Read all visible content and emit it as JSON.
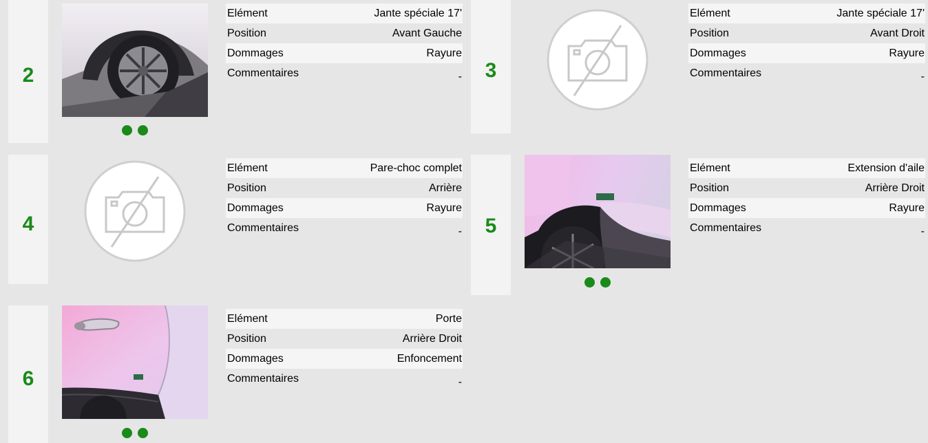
{
  "labels": {
    "element": "Elément",
    "position": "Position",
    "damages": "Dommages",
    "comments": "Commentaires"
  },
  "colors": {
    "accent_green": "#1a8a1a",
    "background": "#e6e6e6",
    "panel": "#f3f3f3"
  },
  "cards": [
    {
      "number": "2",
      "element": "Jante spéciale 17'",
      "position": "Avant Gauche",
      "damages": "Rayure",
      "comments": "-",
      "photo": "wheel-photo",
      "photo_dots": 2
    },
    {
      "number": "3",
      "element": "Jante spéciale 17'",
      "position": "Avant Droit",
      "damages": "Rayure",
      "comments": "-",
      "photo": "no-photo-icon",
      "photo_dots": 0
    },
    {
      "number": "4",
      "element": "Pare-choc complet",
      "position": "Arrière",
      "damages": "Rayure",
      "comments": "-",
      "photo": "no-photo-icon",
      "photo_dots": 0
    },
    {
      "number": "5",
      "element": "Extension d'aile",
      "position": "Arrière Droit",
      "damages": "Rayure",
      "comments": "-",
      "photo": "fender-photo",
      "photo_dots": 2
    },
    {
      "number": "6",
      "element": "Porte",
      "position": "Arrière Droit",
      "damages": "Enfoncement",
      "comments": "-",
      "photo": "door-photo",
      "photo_dots": 2
    }
  ]
}
